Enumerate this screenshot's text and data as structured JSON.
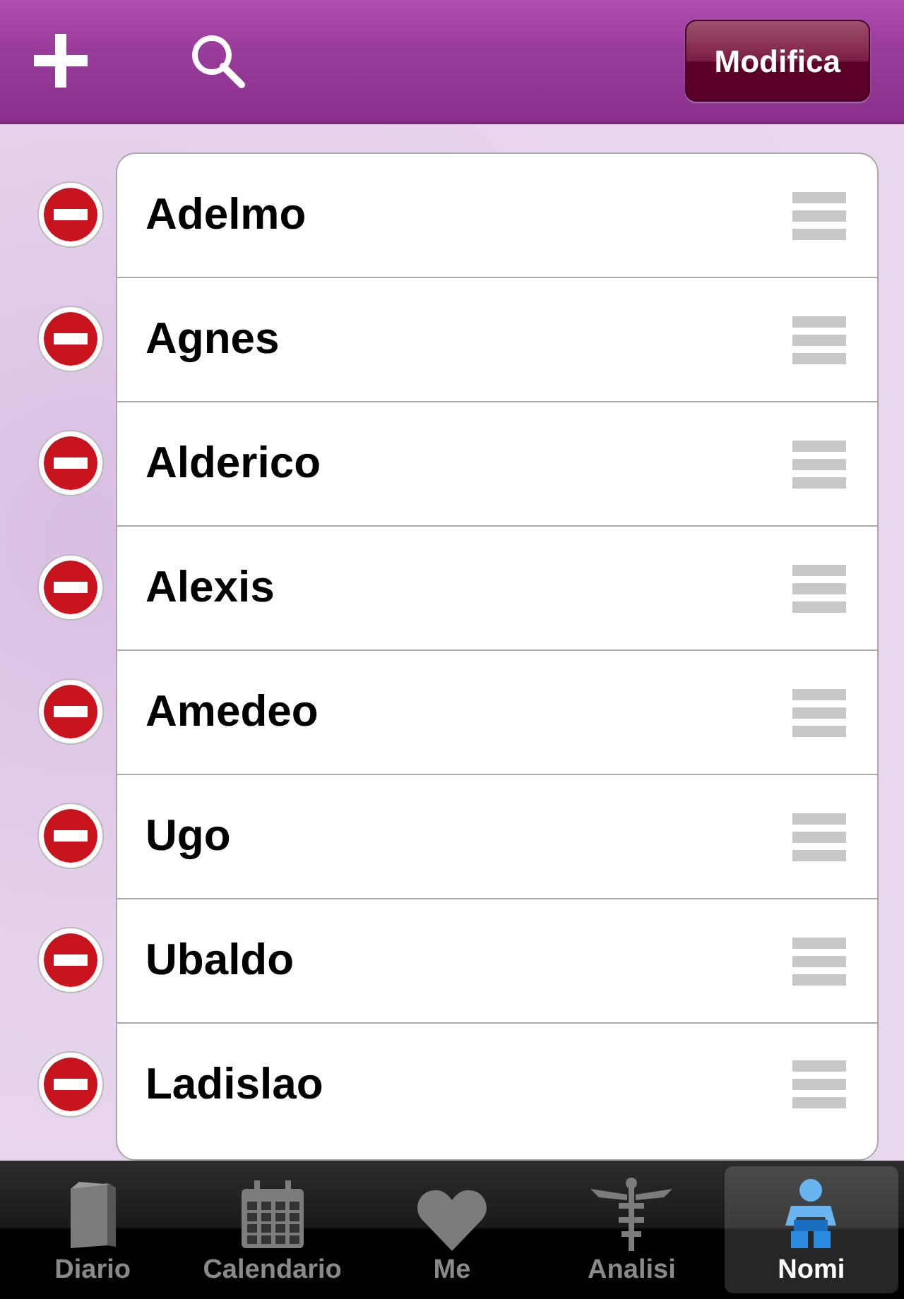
{
  "toolbar": {
    "edit_button": "Modifica"
  },
  "names": [
    {
      "label": "Adelmo"
    },
    {
      "label": "Agnes"
    },
    {
      "label": "Alderico"
    },
    {
      "label": "Alexis"
    },
    {
      "label": "Amedeo"
    },
    {
      "label": "Ugo"
    },
    {
      "label": "Ubaldo"
    },
    {
      "label": "Ladislao"
    }
  ],
  "tabs": [
    {
      "label": "Diario",
      "kind": "book",
      "selected": false
    },
    {
      "label": "Calendario",
      "kind": "calendar",
      "selected": false
    },
    {
      "label": "Me",
      "kind": "heart",
      "selected": false
    },
    {
      "label": "Analisi",
      "kind": "caduceus",
      "selected": false
    },
    {
      "label": "Nomi",
      "kind": "baby",
      "selected": true
    }
  ]
}
